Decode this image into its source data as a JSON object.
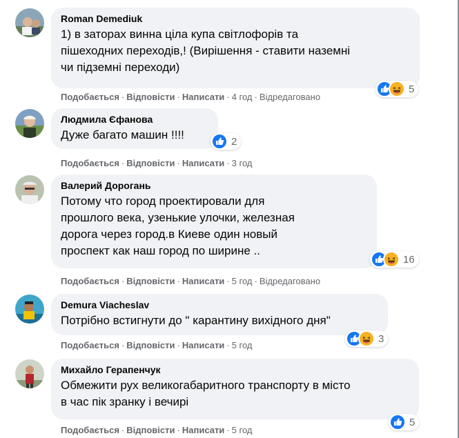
{
  "actions": {
    "like": "Подобається",
    "reply": "Відповісти",
    "write": "Написати",
    "separator": "·",
    "edited": "Відредаговано"
  },
  "comments": [
    {
      "author": "Roman Demediuk",
      "text": "1) в заторах винна ціла купа світлофорів та\nпішеходних переходів,! (Вирішення - ставити наземні\nчи підземні переходи)",
      "time": "4 год",
      "edited": true,
      "reactions": [
        "like-icon",
        "haha-icon"
      ],
      "reaction_count": "5"
    },
    {
      "author": "Людмила Єфанова",
      "text": "Дуже багато машин !!!!",
      "time": "3 год",
      "edited": false,
      "reactions": [
        "like-icon"
      ],
      "reaction_count": "2"
    },
    {
      "author": "Валерий Дорогань",
      "text": "Потому что город проектировали для\nпрошлого века, узенькие улочки, железная\nдорога через город.в Киеве один новый\nпроспект как наш город по ширине ..",
      "time": "5 год",
      "edited": true,
      "reactions": [
        "like-icon",
        "haha-icon"
      ],
      "reaction_count": "16"
    },
    {
      "author": "Demura Viacheslav",
      "text": "Потрібно встигнути до \" карантину вихідного дня\"",
      "time": "5 год",
      "edited": false,
      "reactions": [
        "like-icon",
        "haha-icon"
      ],
      "reaction_count": "3"
    },
    {
      "author": "Михайло Герапенчук",
      "text": "Обмежити рух великогабаритного транспорту в місто\nв час пік зранку і вечирі",
      "time": "5 год",
      "edited": false,
      "reactions": [
        "like-icon"
      ],
      "reaction_count": "5"
    }
  ],
  "colors": {
    "bubble": "#f0f2f5",
    "like_blue": "#1877f2",
    "haha_yellow": "#f7b125",
    "meta_gray": "#65676b"
  }
}
